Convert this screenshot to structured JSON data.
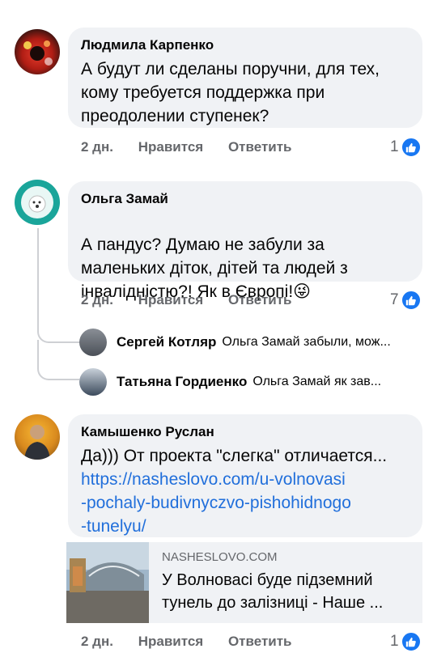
{
  "comments": [
    {
      "author": "Людмила Карпенко",
      "text": "А будут ли сделаны поручни, для тех,\nкому требуется поддержка при\nпреодолении ступенек?",
      "time": "2 дн.",
      "like_label": "Нравится",
      "reply_label": "Ответить",
      "like_count": "1"
    },
    {
      "author": "Ольга Замай",
      "text": "А пандус? Думаю не забули за\nмаленьких діток,  дітей та  людей з\nінвалідністю?! Як в Європі!",
      "emoji": "😜",
      "time": "2 дн.",
      "like_label": "Нравится",
      "reply_label": "Ответить",
      "like_count": "7",
      "replies": [
        {
          "author": "Сергей Котляр",
          "preview": "Ольга Замай забыли, мож..."
        },
        {
          "author": "Татьяна Гордиенко",
          "preview": "Ольга Замай  як зав..."
        }
      ]
    },
    {
      "author": "Камышенко Руслан",
      "text": "Да))) От проекта \"слегка\" отличается...",
      "link": "https://nasheslovo.com/u-volnovasi\n-pochaly-budivnyczvo-pishohidnogo\n-tunelyu/",
      "link_preview": {
        "domain": "NASHESLOVO.COM",
        "title": "У Волновасі буде підземний\nтунель до залізниці - Наше ..."
      },
      "time": "2 дн.",
      "like_label": "Нравится",
      "reply_label": "Ответить",
      "like_count": "1"
    }
  ],
  "colors": {
    "bubble": "#f0f2f5",
    "link": "#216fdb",
    "like": "#1877f2",
    "meta": "#65676b"
  }
}
